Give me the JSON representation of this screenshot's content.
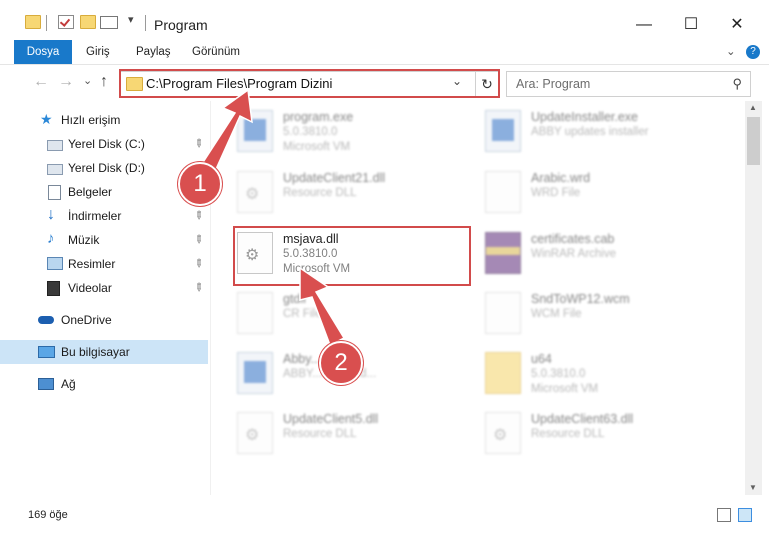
{
  "window": {
    "title": "Program",
    "minimize_label": "—",
    "maximize_label": "☐",
    "close_label": "✕"
  },
  "ribbon": {
    "tabs": [
      "Dosya",
      "Giriş",
      "Paylaş",
      "Görünüm"
    ],
    "help_label": "?",
    "expand_label": "⌄"
  },
  "nav": {
    "back": "←",
    "forward": "→",
    "recent": "⌄",
    "up": "↑",
    "address": "C:\\Program Files\\Program Dizini",
    "dropdown": "⌄",
    "refresh": "↻",
    "search_placeholder": "Ara: Program",
    "search_icon_glyph": "⚲"
  },
  "sidebar": {
    "items": [
      {
        "label": "Hızlı erişim"
      },
      {
        "label": "Yerel Disk (C:)"
      },
      {
        "label": "Yerel Disk (D:)"
      },
      {
        "label": "Belgeler"
      },
      {
        "label": "İndirmeler"
      },
      {
        "label": "Müzik"
      },
      {
        "label": "Resimler"
      },
      {
        "label": "Videolar"
      },
      {
        "label": "OneDrive"
      },
      {
        "label": "Bu bilgisayar"
      },
      {
        "label": "Ağ"
      }
    ],
    "pin_glyph": "📌"
  },
  "files": [
    {
      "name": "program.exe",
      "line1": "5.0.3810.0",
      "line2": "Microsoft VM"
    },
    {
      "name": "UpdateInstaller.exe",
      "line1": "ABBY updates installer",
      "line2": ""
    },
    {
      "name": "UpdateClient21.dll",
      "line1": "Resource DLL",
      "line2": ""
    },
    {
      "name": "Arabic.wrd",
      "line1": "WRD File",
      "line2": ""
    },
    {
      "name": "msjava.dll",
      "line1": "5.0.3810.0",
      "line2": "Microsoft VM"
    },
    {
      "name": "certificates.cab",
      "line1": "WinRAR Archive",
      "line2": ""
    },
    {
      "name": "gtdll",
      "line1": "CR File",
      "line2": ""
    },
    {
      "name": "SndToWP12.wcm",
      "line1": "WCM File",
      "line2": ""
    },
    {
      "name": "Abby...exe",
      "line1": "ABBY...ent hand...",
      "line2": ""
    },
    {
      "name": "u64",
      "line1": "5.0.3810.0",
      "line2": "Microsoft VM"
    },
    {
      "name": "UpdateClient5.dll",
      "line1": "Resource DLL",
      "line2": ""
    },
    {
      "name": "UpdateClient63.dll",
      "line1": "Resource DLL",
      "line2": ""
    }
  ],
  "status": {
    "count": "169 öğe"
  },
  "callouts": [
    "1",
    "2"
  ],
  "colors": {
    "accent": "#1979ca",
    "highlight": "#d24b4b",
    "selected_nav": "#cce4f7"
  }
}
